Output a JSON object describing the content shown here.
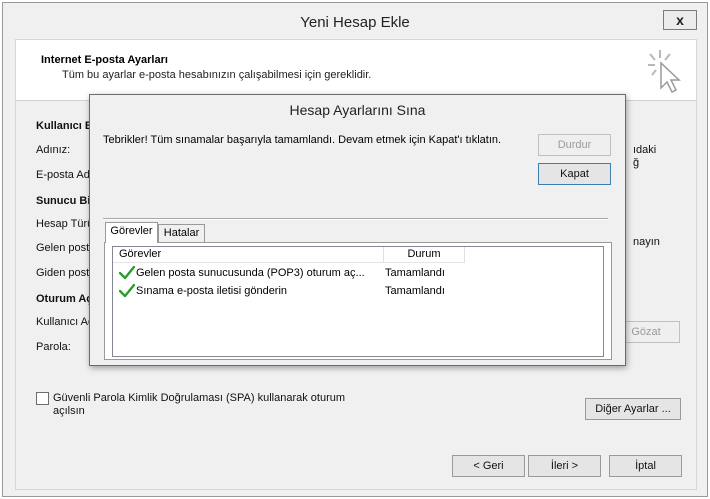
{
  "window": {
    "title": "Yeni Hesap Ekle",
    "close_glyph": "x"
  },
  "header": {
    "title": "Internet E-posta Ayarları",
    "subtitle": "Tüm bu ayarlar e-posta hesabınızın çalışabilmesi için gereklidir."
  },
  "background_form": {
    "section_user": "Kullanıcı B",
    "name_label": "Adınız:",
    "email_label": "E-posta Adr",
    "section_server": "Sunucu Bi",
    "account_type_label": "Hesap Türü",
    "incoming_label": "Gelen posta",
    "outgoing_label": "Giden posta",
    "section_login": "Oturum Aç",
    "username_label": "Kullanıcı Adı",
    "password_label": "Parola:",
    "right_text_1": "ıdaki",
    "right_text_2": "ğ",
    "right_text_3": "nayın",
    "browse_button": "Gözat",
    "spa_label_line1": "Güvenli Parola Kimlik Doğrulaması (SPA) kullanarak oturum",
    "spa_label_line2": "açılsın",
    "more_settings_button": "Diğer Ayarlar ...",
    "back_button": "< Geri",
    "next_button": "İleri >",
    "cancel_button": "İptal"
  },
  "modal": {
    "title": "Hesap Ayarlarını Sına",
    "message": "Tebrikler! Tüm sınamalar başarıyla tamamlandı. Devam etmek için Kapat'ı tıklatın.",
    "stop_button": "Durdur",
    "close_button": "Kapat",
    "tabs": [
      {
        "label": "Görevler",
        "active": true
      },
      {
        "label": "Hatalar",
        "active": false
      }
    ],
    "columns": [
      "Görevler",
      "Durum"
    ],
    "rows": [
      {
        "task": "Gelen posta sunucusunda (POP3) oturum aç...",
        "status": "Tamamlandı",
        "icon": "green-check-icon"
      },
      {
        "task": "Sınama e-posta iletisi gönderin",
        "status": "Tamamlandı",
        "icon": "green-check-icon"
      }
    ]
  },
  "colors": {
    "check_green": "#2e9b2e",
    "focus_border": "#3c7fb1"
  }
}
